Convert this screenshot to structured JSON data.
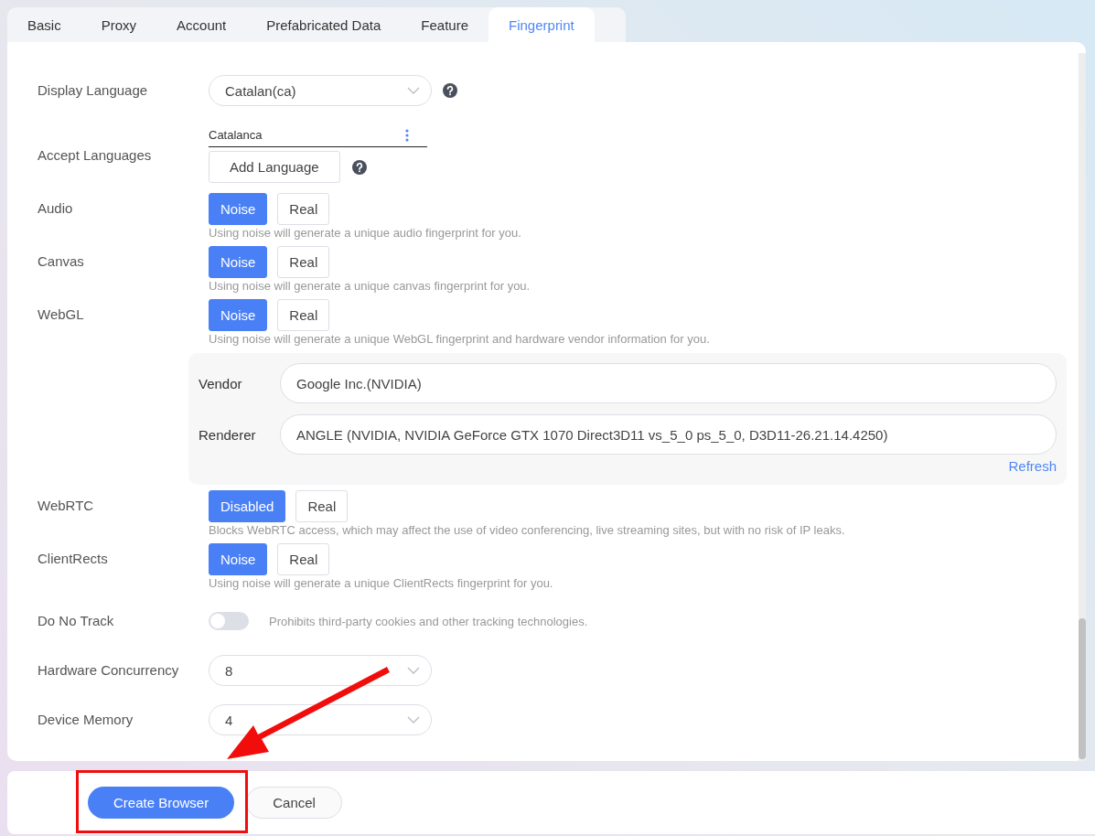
{
  "tabs": [
    {
      "label": "Basic",
      "selected": false
    },
    {
      "label": "Proxy",
      "selected": false
    },
    {
      "label": "Account",
      "selected": false
    },
    {
      "label": "Prefabricated Data",
      "selected": false
    },
    {
      "label": "Feature",
      "selected": false
    },
    {
      "label": "Fingerprint",
      "selected": true
    }
  ],
  "fields": [
    {
      "kind": "select",
      "label": "Display Language",
      "value": "Catalan(ca)",
      "help": true
    },
    {
      "kind": "languages",
      "label": "Accept Languages",
      "languages": [
        "Catalanca"
      ],
      "add_button": "Add Language",
      "help": true
    },
    {
      "kind": "segmented",
      "label": "Audio",
      "options": [
        {
          "label": "Noise",
          "selected": true
        },
        {
          "label": "Real",
          "selected": false
        }
      ],
      "hint": "Using noise will generate a unique audio fingerprint for you."
    },
    {
      "kind": "segmented",
      "label": "Canvas",
      "options": [
        {
          "label": "Noise",
          "selected": true
        },
        {
          "label": "Real",
          "selected": false
        }
      ],
      "hint": "Using noise will generate a unique canvas fingerprint for you."
    },
    {
      "kind": "segmented",
      "label": "WebGL",
      "options": [
        {
          "label": "Noise",
          "selected": true
        },
        {
          "label": "Real",
          "selected": false
        }
      ],
      "hint": "Using noise will generate a unique WebGL fingerprint and hardware vendor information for you."
    },
    {
      "kind": "details",
      "rows": [
        {
          "label": "Vendor",
          "value": "Google Inc.(NVIDIA)"
        },
        {
          "label": "Renderer",
          "value": "ANGLE (NVIDIA, NVIDIA GeForce GTX 1070 Direct3D11 vs_5_0 ps_5_0, D3D11-26.21.14.4250)"
        }
      ],
      "refresh": "Refresh"
    },
    {
      "kind": "segmented",
      "label": "WebRTC",
      "options": [
        {
          "label": "Disabled",
          "selected": true
        },
        {
          "label": "Real",
          "selected": false
        }
      ],
      "hint": "Blocks WebRTC access, which may affect the use of video conferencing, live streaming sites, but with no risk of IP leaks."
    },
    {
      "kind": "segmented",
      "label": "ClientRects",
      "options": [
        {
          "label": "Noise",
          "selected": true
        },
        {
          "label": "Real",
          "selected": false
        }
      ],
      "hint": "Using noise will generate a unique ClientRects fingerprint for you."
    },
    {
      "kind": "toggle",
      "label": "Do No Track",
      "on": false,
      "hint": "Prohibits third-party cookies and other tracking technologies."
    },
    {
      "kind": "select",
      "label": "Hardware Concurrency",
      "value": "8",
      "help": false
    },
    {
      "kind": "select",
      "label": "Device Memory",
      "value": "4",
      "help": false
    }
  ],
  "footer": {
    "buttons": [
      {
        "label": "Create Browser",
        "kind": "primary"
      },
      {
        "label": "Cancel",
        "kind": "secondary"
      }
    ]
  }
}
